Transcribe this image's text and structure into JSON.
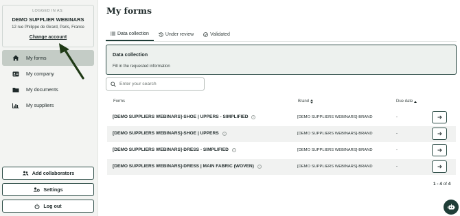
{
  "sidebar": {
    "account": {
      "label": "LOGGED IN AS:",
      "name": "DEMO SUPPLIER WEBINARS",
      "address": "12 rue Philippe de Girard, Paris, France",
      "change_label": "Change account"
    },
    "nav": [
      {
        "label": "My forms",
        "icon": "home-icon",
        "active": true
      },
      {
        "label": "My company",
        "icon": "id-card-icon",
        "active": false
      },
      {
        "label": "My documents",
        "icon": "folder-icon",
        "active": false
      },
      {
        "label": "My suppliers",
        "icon": "chart-icon",
        "active": false
      }
    ],
    "buttons": {
      "add_collaborators": "Add collaborators",
      "settings": "Settings",
      "logout": "Log out"
    }
  },
  "main": {
    "title": "My forms",
    "tabs": [
      {
        "label": "Data collection",
        "icon": "list-icon",
        "active": true
      },
      {
        "label": "Under review",
        "icon": "history-icon",
        "active": false
      },
      {
        "label": "Validated",
        "icon": "check-circle-icon",
        "active": false
      }
    ],
    "info": {
      "title": "Data collection",
      "subtitle": "Fill in the requested information"
    },
    "search": {
      "placeholder": "Enter your search",
      "value": ""
    },
    "table": {
      "headers": {
        "forms": "Forms",
        "brand": "Brand",
        "due_date": "Due date"
      },
      "rows": [
        {
          "form": "[DEMO SUPPLIERS WEBINARS]-SHOE | UPPERS - SIMPLIFIED",
          "brand": "[DEMO SUPPLIERS WEBINARS]-BRAND",
          "due": "-"
        },
        {
          "form": "[DEMO SUPPLIERS WEBINARS]-SHOE | UPPERS",
          "brand": "[DEMO SUPPLIERS WEBINARS]-BRAND",
          "due": "-"
        },
        {
          "form": "[DEMO SUPPLIERS WEBINARS]-DRESS - SIMPLIFIED",
          "brand": "[DEMO SUPPLIERS WEBINARS]-BRAND",
          "due": "-"
        },
        {
          "form": "[DEMO SUPPLIERS WEBINARS]-DRESS | MAIN FABRIC (WOVEN)",
          "brand": "[DEMO SUPPLIERS WEBINARS]-BRAND",
          "due": "-"
        }
      ]
    },
    "pagination": {
      "range": "1 - 4",
      "of": "of",
      "total": "4"
    }
  },
  "colors": {
    "accent": "#1f3d37",
    "active_nav": "#c4ccc6",
    "sidebar_bg": "#f3f4f2",
    "annotation_arrow": "#1f3a16"
  }
}
